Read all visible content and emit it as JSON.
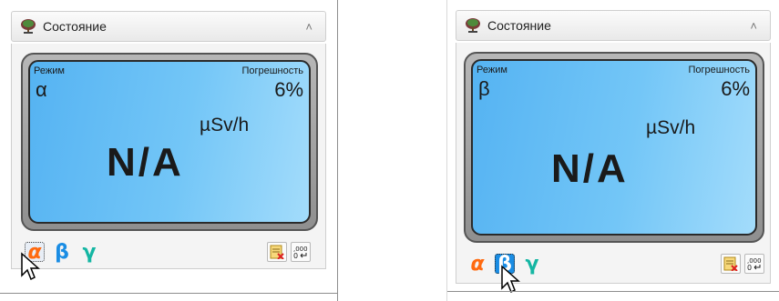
{
  "colors": {
    "lcd_start": "#55b3f2",
    "lcd_end": "#a3dcfb",
    "alpha_color": "#ff6a10",
    "beta_color": "#1a8de4",
    "gamma_color": "#14b6a3"
  },
  "panels": [
    {
      "header": {
        "title": "Состояние",
        "collapse_icon": "chevron-up-icon"
      },
      "display": {
        "mode_label": "Режим",
        "mode_value": "α",
        "error_label": "Погрешность",
        "error_value": "6%",
        "reading": "N/A",
        "unit": "µSv/h"
      },
      "toolbar": {
        "alpha": "α",
        "beta": "β",
        "gamma": "γ",
        "selected": "alpha",
        "clear_icon": "clear-log-icon",
        "format_icon": "number-format-icon"
      }
    },
    {
      "header": {
        "title": "Состояние",
        "collapse_icon": "chevron-up-icon"
      },
      "display": {
        "mode_label": "Режим",
        "mode_value": "β",
        "error_label": "Погрешность",
        "error_value": "6%",
        "reading": "N/A",
        "unit": "µSv/h"
      },
      "toolbar": {
        "alpha": "α",
        "beta": "β",
        "gamma": "γ",
        "selected": "beta",
        "clear_icon": "clear-log-icon",
        "format_icon": "number-format-icon"
      }
    }
  ]
}
